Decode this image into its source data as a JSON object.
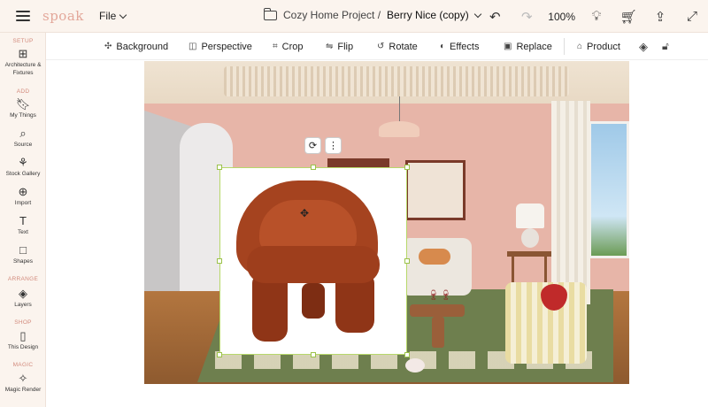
{
  "header": {
    "logo": "spoak",
    "file_menu": "File",
    "project": "Cozy Home Project /",
    "design_name": "Berry Nice (copy)",
    "zoom": "100%",
    "icons": [
      "undo-icon",
      "redo-icon",
      "lightbulb-icon",
      "cart-icon",
      "share-icon",
      "expand-icon"
    ]
  },
  "sidebar": {
    "sections": {
      "setup": "SETUP",
      "add": "ADD",
      "arrange": "ARRANGE",
      "shop": "SHOP",
      "magic": "MAGIC"
    },
    "items": [
      {
        "label": "Architecture & Fixtures",
        "icon": "grid-icon"
      },
      {
        "label": "My Things",
        "icon": "bookmark-icon"
      },
      {
        "label": "Source",
        "icon": "search-icon"
      },
      {
        "label": "Stock Gallery",
        "icon": "gallery-icon"
      },
      {
        "label": "Import",
        "icon": "plus-circle-icon"
      },
      {
        "label": "Text",
        "icon": "text-icon"
      },
      {
        "label": "Shapes",
        "icon": "square-icon"
      },
      {
        "label": "Layers",
        "icon": "layers-icon"
      },
      {
        "label": "This Design",
        "icon": "clipboard-icon"
      },
      {
        "label": "Magic Render",
        "icon": "wand-icon"
      }
    ]
  },
  "toolbar": {
    "items": [
      {
        "label": "Background",
        "icon": "background-icon"
      },
      {
        "label": "Perspective",
        "icon": "perspective-icon"
      },
      {
        "label": "Crop",
        "icon": "crop-icon"
      },
      {
        "label": "Flip",
        "icon": "flip-icon"
      },
      {
        "label": "Rotate",
        "icon": "rotate-icon"
      },
      {
        "label": "Effects",
        "icon": "effects-icon"
      },
      {
        "label": "Replace",
        "icon": "replace-icon"
      },
      {
        "label": "Product",
        "icon": "tag-icon"
      }
    ],
    "extra_icons": [
      "layers-icon",
      "unlock-icon"
    ]
  },
  "selection": {
    "context_icons": [
      "swap-icon",
      "more-icon"
    ],
    "cursor": "move-icon"
  },
  "colors": {
    "bar_bg": "#fbf4ee",
    "accent": "#d28a7c",
    "selection": "#b7d86a",
    "chair": "#a5431f"
  }
}
